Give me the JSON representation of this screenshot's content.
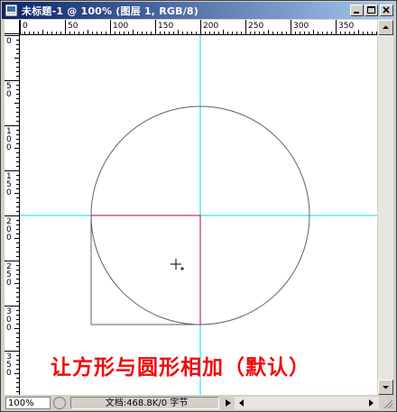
{
  "window": {
    "title": "未标题-1 @ 100% (图层 1, RGB/8)",
    "minimize_symbol": "_",
    "maximize_symbol": "□",
    "close_symbol": "×"
  },
  "ruler_h": {
    "labels": [
      "0",
      "50",
      "100",
      "150",
      "200",
      "250",
      "300",
      "350"
    ]
  },
  "ruler_v": {
    "labels": [
      "0",
      "50",
      "100",
      "150",
      "200",
      "250",
      "300",
      "350"
    ]
  },
  "canvas": {
    "caption": "让方形与圆形相加（默认）",
    "guide_color": "#00e0e0",
    "path_color": "#606060",
    "selection_color": "#c00040"
  },
  "status": {
    "zoom": "100%",
    "doc_info": "文档:468.8K/0 字节"
  },
  "icons": {
    "app": "photoshop-document-icon",
    "status": "status-indicator-icon",
    "cursor": "crosshair-add-cursor-icon"
  }
}
